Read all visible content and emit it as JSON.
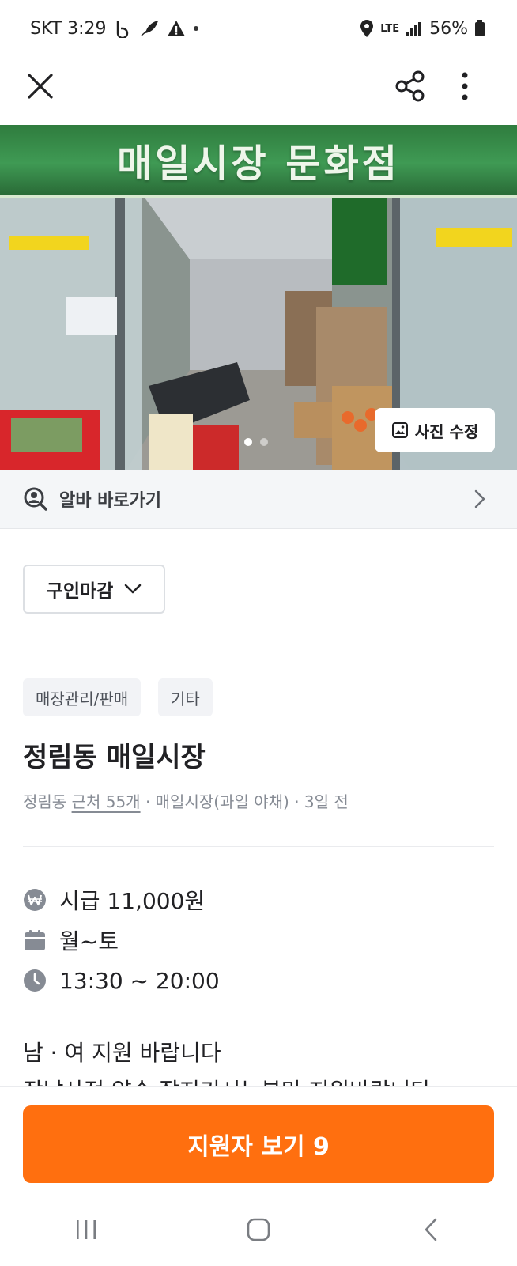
{
  "status_bar": {
    "carrier_time": "SKT 3:29",
    "network": "LTE",
    "battery": "56%"
  },
  "app_bar": {
    "close_icon": "close-icon",
    "share_icon": "share-icon",
    "more_icon": "more-vertical-icon"
  },
  "photo": {
    "banner_text": "매일시장 문화점",
    "edit_label": "사진 수정",
    "page_count": 2,
    "active_page": 1
  },
  "alba_shortcut": {
    "label": "알바 바로가기"
  },
  "recruit_status": {
    "selected": "구인마감"
  },
  "tags": [
    "매장관리/판매",
    "기타"
  ],
  "post": {
    "title": "정림동 매일시장",
    "location": "정림동",
    "nearby": "근처 55개",
    "store": "· 매일시장(과일 야채)",
    "posted": "· 3일 전"
  },
  "details": {
    "wage": "시급 11,000원",
    "days": "월~토",
    "hours": "13:30 ~ 20:00"
  },
  "description": {
    "line1": "남 · 여  지원 바랍니다",
    "line2": "장날사정 약속 잘지키시는분만 지원바랍니다"
  },
  "cta": {
    "label": "지원자 보기 9"
  },
  "colors": {
    "accent": "#ff6f0f",
    "text_primary": "#212124",
    "text_secondary": "#868b94"
  }
}
